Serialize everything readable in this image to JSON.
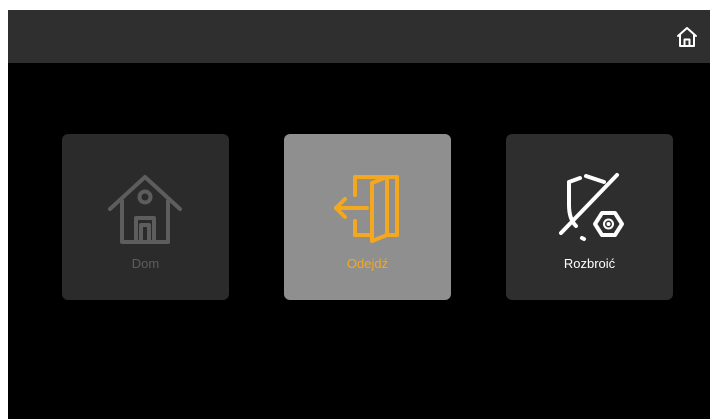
{
  "colors": {
    "background": "#000000",
    "topbar": "#2f2f2f",
    "tile_disabled": "#2b2b2b",
    "tile_selected": "#8f8f8f",
    "tile_normal": "#2e2e2e",
    "accent": "#f3a820",
    "disabled_text": "#5d5d5d",
    "text": "#ffffff"
  },
  "header": {
    "home_icon": "home-icon"
  },
  "modes": [
    {
      "label": "Dom",
      "icon": "house-icon",
      "state": "disabled"
    },
    {
      "label": "Odejdź",
      "icon": "exit-door-icon",
      "state": "selected"
    },
    {
      "label": "Rozbroić",
      "icon": "shield-disarm-icon",
      "state": "normal"
    }
  ]
}
